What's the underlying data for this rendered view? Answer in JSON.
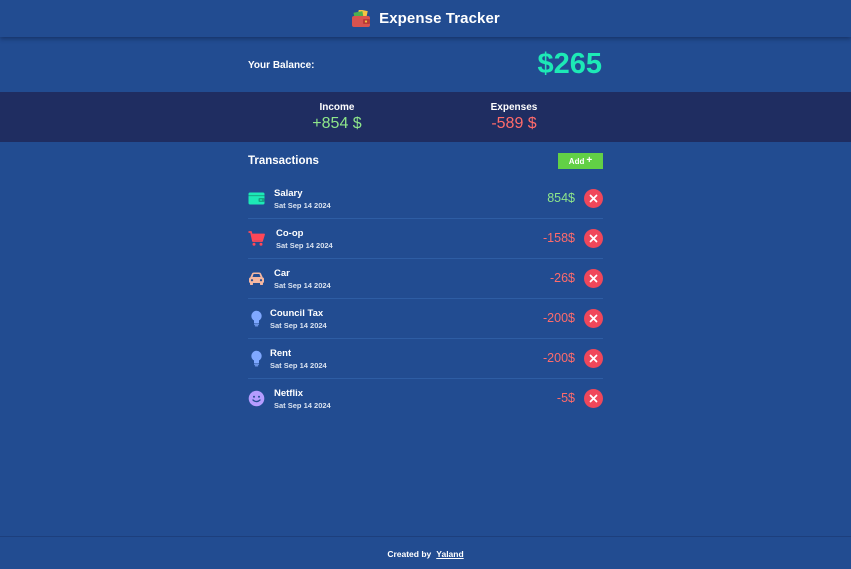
{
  "header": {
    "title": "Expense Tracker",
    "logo_icon": "wallet-icon"
  },
  "balance": {
    "label": "Your Balance:",
    "value": "$265"
  },
  "summary": {
    "income_label": "Income",
    "income_value": "+854 $",
    "expenses_label": "Expenses",
    "expenses_value": "-589 $"
  },
  "transactions": {
    "title": "Transactions",
    "add_label": "Add",
    "add_icon": "plus-icon",
    "items": [
      {
        "name": "Salary",
        "date": "Sat Sep 14 2024",
        "amount": "854$",
        "type": "income",
        "icon": "wallet-icon",
        "icon_color": "#1de9b6"
      },
      {
        "name": "Co-op",
        "date": "Sat Sep 14 2024",
        "amount": "-158$",
        "type": "expense",
        "icon": "shopping-cart-icon",
        "icon_color": "#ff4757"
      },
      {
        "name": "Car",
        "date": "Sat Sep 14 2024",
        "amount": "-26$",
        "type": "expense",
        "icon": "car-icon",
        "icon_color": "#f5b7a1"
      },
      {
        "name": "Council Tax",
        "date": "Sat Sep 14 2024",
        "amount": "-200$",
        "type": "expense",
        "icon": "lightbulb-icon",
        "icon_color": "#7fa8ff"
      },
      {
        "name": "Rent",
        "date": "Sat Sep 14 2024",
        "amount": "-200$",
        "type": "expense",
        "icon": "lightbulb-icon",
        "icon_color": "#7fa8ff"
      },
      {
        "name": "Netflix",
        "date": "Sat Sep 14 2024",
        "amount": "-5$",
        "type": "expense",
        "icon": "smiley-icon",
        "icon_color": "#b59cff"
      }
    ]
  },
  "footer": {
    "created_by": "Created by",
    "author": "Yaland"
  },
  "colors": {
    "background": "#224c91",
    "summary_band": "#1f2d61",
    "balance": "#1de9b6",
    "income": "#8ee68a",
    "expense": "#ff6b6b",
    "add_button": "#62d046",
    "delete_button": "#f0475a"
  }
}
